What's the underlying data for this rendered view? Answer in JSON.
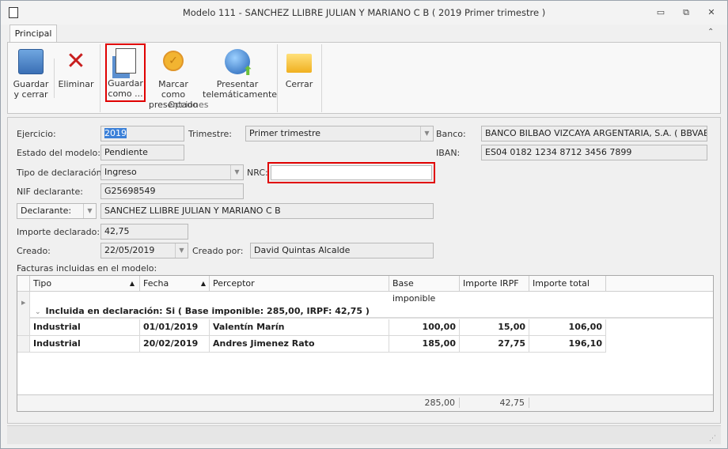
{
  "window": {
    "title": "Modelo 111 -  SANCHEZ LLIBRE JULIAN Y MARIANO C B ( 2019 Primer trimestre )",
    "minimize": "▭",
    "restore": "⧉",
    "close": "✕"
  },
  "ribbon": {
    "tab": "Principal",
    "collapse": "⌃",
    "group_label": "Opciones",
    "buttons": [
      {
        "label1": "Guardar",
        "label2": "y cerrar"
      },
      {
        "label1": "Eliminar",
        "label2": ""
      },
      {
        "label1": "Guardar",
        "label2": "como ..."
      },
      {
        "label1": "Marcar como",
        "label2": "presentado"
      },
      {
        "label1": "Presentar",
        "label2": "telemáticamente"
      },
      {
        "label1": "Cerrar",
        "label2": ""
      }
    ]
  },
  "form": {
    "ejercicio_label": "Ejercicio:",
    "ejercicio": "2019",
    "trimestre_label": "Trimestre:",
    "trimestre": "Primer trimestre",
    "banco_label": "Banco:",
    "banco": "BANCO BILBAO VIZCAYA ARGENTARIA, S.A. ( BBVAESMM)",
    "estado_label": "Estado del modelo:",
    "estado": "Pendiente",
    "iban_label": "IBAN:",
    "iban": "ES04 0182 1234 8712 3456 7899",
    "tipo_label": "Tipo de declaración:",
    "tipo": "Ingreso",
    "nrc_label": "NRC:",
    "nrc": "",
    "nif_label": "NIF declarante:",
    "nif": "G25698549",
    "declarante_type": "Declarante:",
    "declarante": "SANCHEZ LLIBRE JULIAN Y MARIANO C B",
    "importe_label": "Importe declarado:",
    "importe": "42,75",
    "creado_label": "Creado:",
    "creado": "22/05/2019",
    "creado_por_label": "Creado por:",
    "creado_por": "David Quintas Alcalde",
    "facturas_label": "Facturas incluidas en el modelo:"
  },
  "grid": {
    "columns": [
      "Tipo",
      "Fecha",
      "Perceptor",
      "Base imponible",
      "Importe IRPF",
      "Importe total"
    ],
    "group": "Incluida en declaración: Si ( Base imponible: 285,00,  IRPF: 42,75 )",
    "rows": [
      {
        "tipo": "Industrial",
        "fecha": "01/01/2019",
        "perceptor": "Valentín Marín",
        "base": "100,00",
        "irpf": "15,00",
        "total": "106,00"
      },
      {
        "tipo": "Industrial",
        "fecha": "20/02/2019",
        "perceptor": "Andres Jimenez Rato",
        "base": "185,00",
        "irpf": "27,75",
        "total": "196,10"
      }
    ],
    "footer": {
      "base": "285,00",
      "irpf": "42,75"
    }
  }
}
